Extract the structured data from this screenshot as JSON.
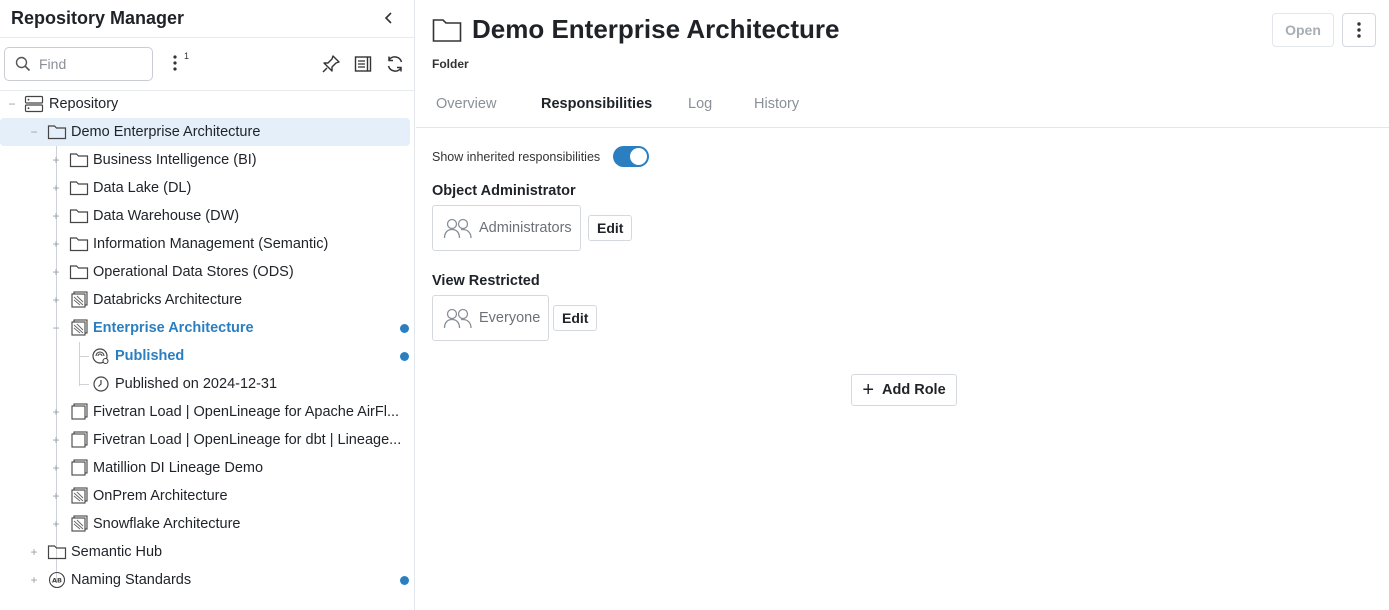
{
  "left_panel": {
    "title": "Repository Manager",
    "find_placeholder": "Find",
    "filter_count": "1"
  },
  "tree": {
    "root": "Repository",
    "selected": "Demo Enterprise Architecture",
    "children": [
      {
        "label": "Business Intelligence (BI)",
        "icon": "folder-icon"
      },
      {
        "label": "Data Lake (DL)",
        "icon": "folder-icon"
      },
      {
        "label": "Data Warehouse (DW)",
        "icon": "folder-icon"
      },
      {
        "label": "Information Management (Semantic)",
        "icon": "folder-icon"
      },
      {
        "label": "Operational Data Stores (ODS)",
        "icon": "folder-icon"
      },
      {
        "label": "Databricks Architecture",
        "icon": "model-stack-icon"
      },
      {
        "label": "Enterprise Architecture",
        "icon": "model-stack-icon"
      },
      {
        "label": "Fivetran Load | OpenLineage for Apache AirFl...",
        "icon": "model-icon"
      },
      {
        "label": "Fivetran Load | OpenLineage for dbt | Lineage...",
        "icon": "model-icon"
      },
      {
        "label": "Matillion DI Lineage Demo",
        "icon": "model-icon"
      },
      {
        "label": "OnPrem Architecture",
        "icon": "model-stack-icon"
      },
      {
        "label": "Snowflake Architecture",
        "icon": "model-stack-icon"
      }
    ],
    "versions": [
      {
        "label": "Published",
        "icon": "published-icon"
      },
      {
        "label": "Published on 2024-12-31",
        "icon": "clock-icon"
      }
    ],
    "siblings": [
      {
        "label": "Semantic Hub",
        "icon": "folder-icon"
      },
      {
        "label": "Naming Standards",
        "icon": "naming-standards-icon"
      }
    ],
    "accent_color": "#2b7fc0"
  },
  "object": {
    "title": "Demo Enterprise Architecture",
    "type": "Folder",
    "open_label": "Open"
  },
  "tabs": [
    "Overview",
    "Responsibilities",
    "Log",
    "History"
  ],
  "active_tab": "Responsibilities",
  "responsibilities": {
    "inherited_label": "Show inherited responsibilities",
    "inherited_on": true,
    "roles": [
      {
        "title": "Object Administrator",
        "assignee": "Administrators",
        "edit_label": "Edit"
      },
      {
        "title": "View Restricted",
        "assignee": "Everyone",
        "edit_label": "Edit"
      }
    ],
    "add_role_label": "Add Role"
  }
}
